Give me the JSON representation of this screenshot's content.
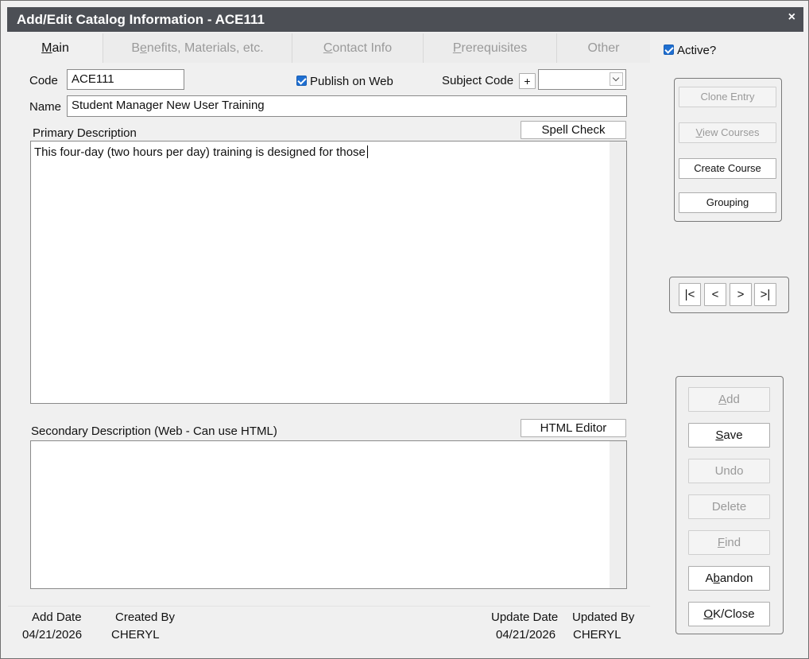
{
  "window": {
    "title": "Add/Edit Catalog Information - ACE111",
    "close_glyph": "×"
  },
  "tabs": [
    {
      "label_u": "M",
      "label_rest": "ain"
    },
    {
      "label_pre": "B",
      "label_u": "e",
      "label_rest": "nefits, Materials, etc."
    },
    {
      "label_u": "C",
      "label_rest": "ontact Info"
    },
    {
      "label_u": "P",
      "label_rest": "rerequisites"
    },
    {
      "label": "Other"
    }
  ],
  "form": {
    "code_label": "Code",
    "code_value": "ACE111",
    "publish_label": "Publish on Web",
    "subject_code_label": "Subject Code",
    "subject_add_glyph": "+",
    "subject_value": "",
    "name_label": "Name",
    "name_value": "Student Manager New User Training",
    "primary_desc_label": "Primary Description",
    "spell_check_label": "Spell Check",
    "primary_desc_value": "This four-day (two hours per day) training is designed for those",
    "secondary_desc_label": "Secondary Description (Web - Can use HTML)",
    "html_editor_label": "HTML Editor",
    "secondary_desc_value": ""
  },
  "footer": {
    "add_date_label": "Add Date",
    "add_date_value": "04/21/2026",
    "created_by_label": "Created By",
    "created_by_value": "CHERYL",
    "update_date_label": "Update Date",
    "update_date_value": "04/21/2026",
    "updated_by_label": "Updated By",
    "updated_by_value": "CHERYL"
  },
  "side": {
    "active_label": "Active?",
    "clone_entry": "Clone Entry",
    "view_courses_u": "V",
    "view_courses_rest": "iew Courses",
    "create_course": "Create Course",
    "grouping": "Grouping",
    "nav_first": "|<",
    "nav_prev": "<",
    "nav_next": ">",
    "nav_last": ">|",
    "add_u": "A",
    "add_rest": "dd",
    "save_u": "S",
    "save_rest": "ave",
    "undo": "Undo",
    "delete": "Delete",
    "find_u": "F",
    "find_rest": "ind",
    "abandon_pre": "A",
    "abandon_u": "b",
    "abandon_rest": "andon",
    "ok_u": "O",
    "ok_rest": "K/Close"
  },
  "colors": {
    "titlebar": "#4c4f55",
    "checkbox": "#1f6fd1",
    "disabled_text": "#9a9a9a"
  }
}
